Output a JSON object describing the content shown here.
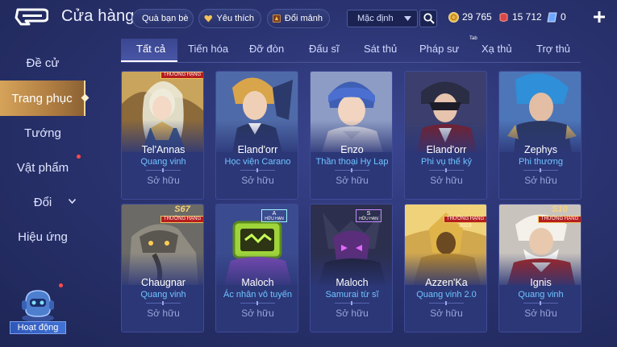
{
  "header": {
    "title": "Cửa hàng",
    "gift_label": "Quà bạn bè",
    "favorite_label": "Yêu thích",
    "exchange_label": "Đổi mảnh",
    "sort_value": "Mặc định",
    "gold": "29 765",
    "rubies": "15 712",
    "vouchers": "0"
  },
  "sidebar": {
    "items": [
      {
        "label": "Đề cử"
      },
      {
        "label": "Trang phục"
      },
      {
        "label": "Tướng"
      },
      {
        "label": "Vật phẩm"
      },
      {
        "label": "Đổi"
      },
      {
        "label": "Hiệu ứng"
      }
    ],
    "event_label": "Hoạt động"
  },
  "tabs": [
    {
      "label": "Tất cả"
    },
    {
      "label": "Tiến hóa"
    },
    {
      "label": "Đỡ đòn"
    },
    {
      "label": "Đấu sĩ"
    },
    {
      "label": "Sát thủ"
    },
    {
      "label": "Pháp sư"
    },
    {
      "label": "Xạ thủ"
    },
    {
      "label": "Trợ thủ"
    }
  ],
  "tab_badge": "Tab",
  "cards": [
    {
      "hero": "Tel'Annas",
      "skin": "Quang vinh",
      "status": "Sở hữu",
      "badge_ribbon": "THƯỜNG HẠNG"
    },
    {
      "hero": "Eland'orr",
      "skin": "Học viện Carano",
      "status": "Sở hữu"
    },
    {
      "hero": "Enzo",
      "skin": "Thần thoại Hy Lạp",
      "status": "Sở hữu"
    },
    {
      "hero": "Eland'orr",
      "skin": "Phi vụ thế kỷ",
      "status": "Sở hữu"
    },
    {
      "hero": "Zephys",
      "skin": "Phi thương",
      "status": "Sở hữu"
    },
    {
      "hero": "Chaugnar",
      "skin": "Quang vinh",
      "status": "Sở hữu",
      "badge_code": "S67",
      "badge_ribbon": "THƯỜNG HẠNG"
    },
    {
      "hero": "Maloch",
      "skin": "Ác nhân vô tuyến",
      "status": "Sở hữu",
      "badge_code": "A",
      "badge_ribbon": "HỮU HẠN"
    },
    {
      "hero": "Maloch",
      "skin": "Samurai từ sĩ",
      "status": "Sở hữu",
      "badge_code": "S",
      "badge_ribbon": "HỮU HẠN"
    },
    {
      "hero": "Azzen'Ka",
      "skin": "Quang vinh 2.0",
      "status": "Sở hữu",
      "badge_code": "S4",
      "badge_ribbon": "THƯỜNG HẠNG",
      "badge_year": "2023"
    },
    {
      "hero": "Ignis",
      "skin": "Quang vinh",
      "status": "Sở hữu",
      "badge_code": "S10",
      "badge_ribbon": "THƯỜNG HẠNG"
    }
  ],
  "colors": {
    "background": "#2a3370",
    "active_sidebar": "#c08e4c",
    "skin_text": "#6fc4ff",
    "notification_dot": "#ff4a4a"
  }
}
